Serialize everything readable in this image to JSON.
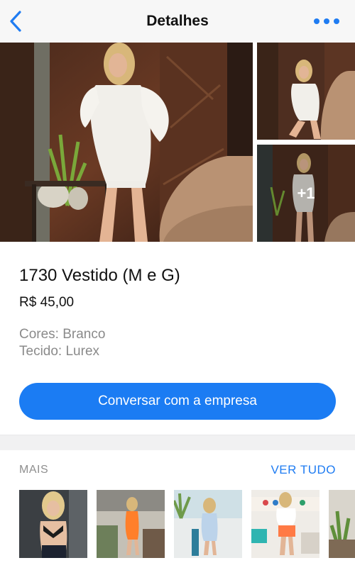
{
  "header": {
    "title": "Detalhes",
    "back_icon": "chevron-left-icon",
    "more_icon": "more-horizontal-icon",
    "accent": "#1f7cf2"
  },
  "gallery": {
    "extra_count_label": "+1"
  },
  "product": {
    "title": "1730 Vestido (M e G)",
    "price": "R$ 45,00",
    "colors": "Cores: Branco",
    "fabric": "Tecido: Lurex",
    "chat_button_label": "Conversar com a empresa",
    "button_color": "#1b7cf3"
  },
  "more_section": {
    "label": "MAIS",
    "see_all_label": "VER TUDO"
  }
}
